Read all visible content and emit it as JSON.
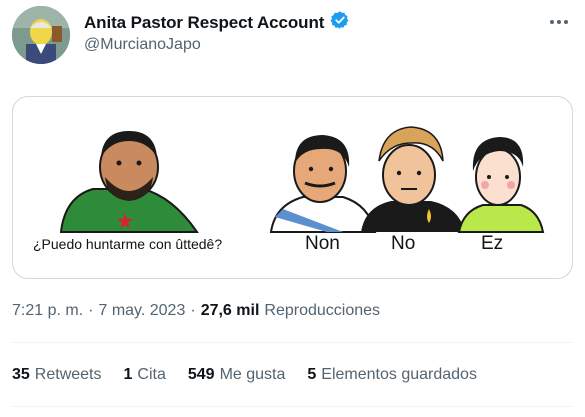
{
  "author": {
    "display_name": "Anita Pastor Respect Account",
    "handle": "@MurcianoJapo",
    "verified": true,
    "verified_color": "#1d9bf0"
  },
  "media": {
    "caption": "¿Puedo huntarme con ûttedê?",
    "labels": [
      "Non",
      "No",
      "Ez"
    ]
  },
  "meta": {
    "time": "7:21 p. m.",
    "date": "7 may. 2023",
    "views_count": "27,6 mil",
    "views_label": "Reproducciones"
  },
  "stats": [
    {
      "count": "35",
      "label": "Retweets"
    },
    {
      "count": "1",
      "label": "Cita"
    },
    {
      "count": "549",
      "label": "Me gusta"
    },
    {
      "count": "5",
      "label": "Elementos guardados"
    }
  ],
  "icons": [
    "avatar",
    "verified-badge-icon",
    "more-options-icon"
  ],
  "colors": {
    "text": "#0f1419",
    "secondary": "#536471",
    "border": "#cfd9de"
  }
}
